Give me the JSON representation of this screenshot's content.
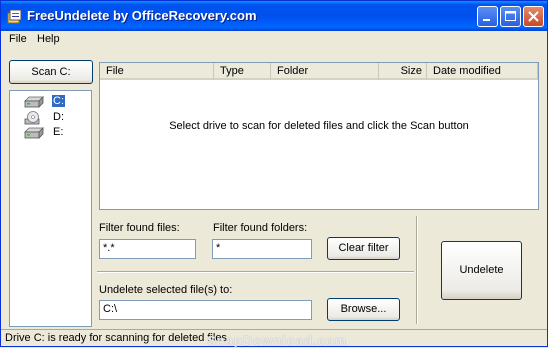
{
  "window": {
    "title": "FreeUndelete by OfficeRecovery.com"
  },
  "menu": {
    "file": "File",
    "help": "Help"
  },
  "left_panel": {
    "scan_button": "Scan C:",
    "drives": [
      {
        "label": "C:",
        "icon": "hard-drive-icon",
        "selected": true
      },
      {
        "label": "D:",
        "icon": "cd-drive-icon",
        "selected": false
      },
      {
        "label": "E:",
        "icon": "hard-drive-icon",
        "selected": false
      }
    ]
  },
  "file_list": {
    "columns": [
      "File",
      "Type",
      "Folder",
      "Size",
      "Date modified"
    ],
    "empty_message": "Select drive to scan for deleted files and click the Scan button"
  },
  "filters": {
    "files_label": "Filter found files:",
    "files_value": "*.*",
    "folders_label": "Filter found folders:",
    "folders_value": "*",
    "clear_button": "Clear filter"
  },
  "destination": {
    "label": "Undelete selected file(s) to:",
    "value": "C:\\",
    "browse_button": "Browse..."
  },
  "undelete_button": "Undelete",
  "status": {
    "text": "Drive C: is ready for scanning for deleted files"
  },
  "watermark": "SnapDownload.com",
  "colors": {
    "titlebar": "#0054e3",
    "selection": "#316ac5",
    "window_bg": "#ece9d8"
  }
}
